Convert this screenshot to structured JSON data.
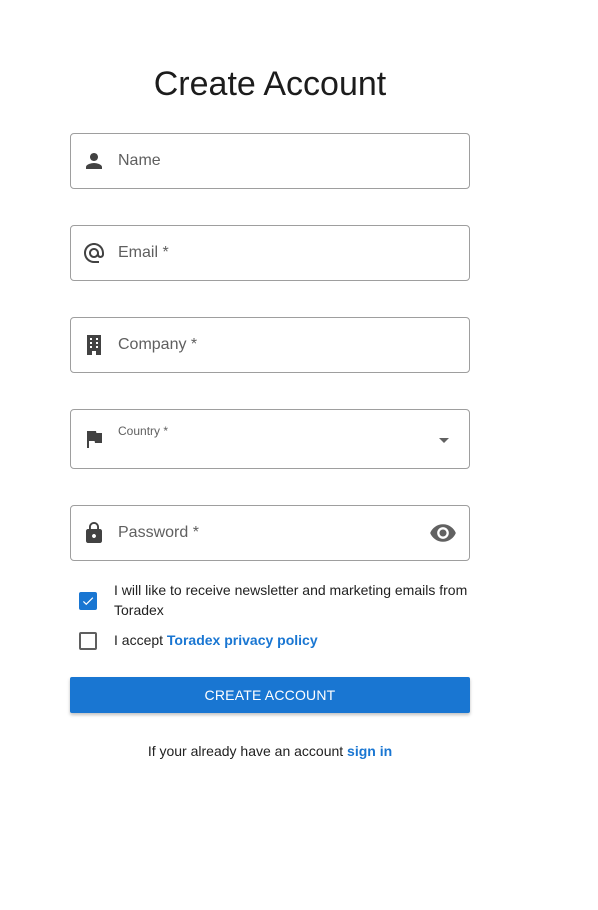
{
  "page": {
    "title": "Create Account"
  },
  "form": {
    "name": {
      "placeholder": "Name",
      "icon": "person-icon"
    },
    "email": {
      "placeholder": "Email *",
      "icon": "at-sign-icon"
    },
    "company": {
      "placeholder": "Company *",
      "icon": "building-icon"
    },
    "country": {
      "label": "Country *",
      "value": "",
      "icon": "flag-icon"
    },
    "password": {
      "placeholder": "Password *",
      "icon": "lock-icon",
      "toggle_icon": "eye-icon"
    },
    "newsletter": {
      "checked": true,
      "label": "I will like to receive newsletter and marketing emails from Toradex"
    },
    "privacy": {
      "checked": false,
      "text": "I accept",
      "link": "Toradex privacy policy"
    },
    "submit_label": "Create Account"
  },
  "footer": {
    "text": "If your already have an account",
    "link": "sign in"
  },
  "colors": {
    "primary": "#1976d2",
    "border": "#9e9e9e",
    "icon": "#424242",
    "text_secondary": "#5f5f5f"
  }
}
